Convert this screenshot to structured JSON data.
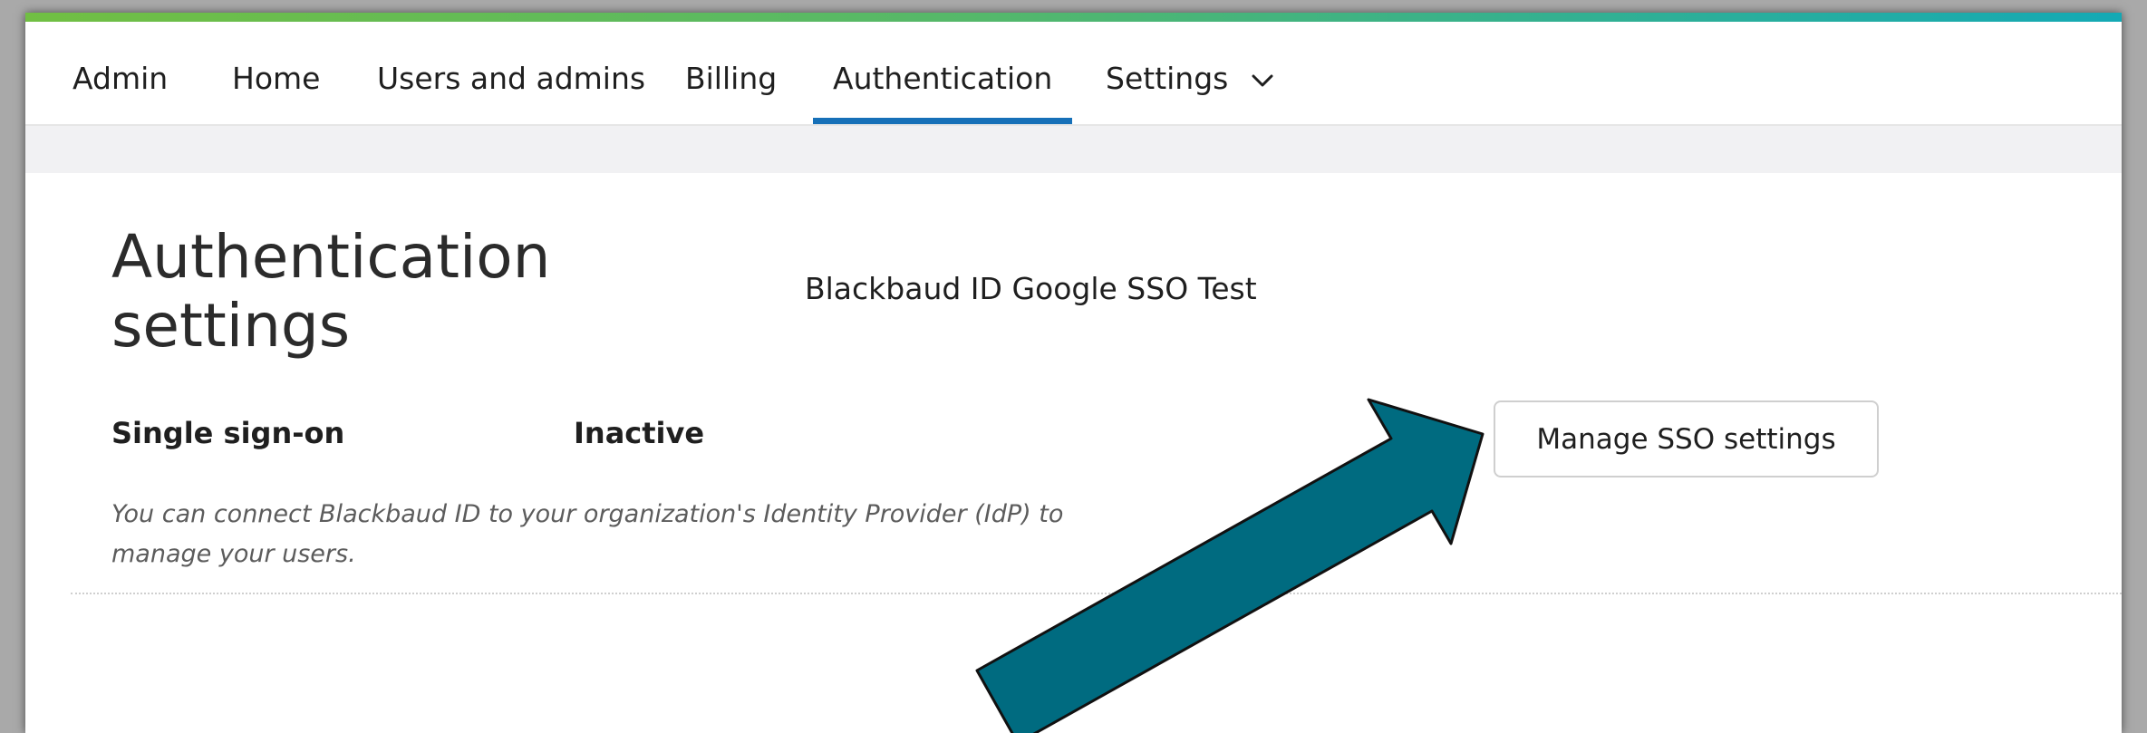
{
  "nav": {
    "items": [
      {
        "label": "Admin"
      },
      {
        "label": "Home"
      },
      {
        "label": "Users and admins"
      },
      {
        "label": "Billing"
      },
      {
        "label": "Authentication",
        "active": true
      },
      {
        "label": "Settings",
        "icon": "chevron-down-icon"
      }
    ]
  },
  "page": {
    "title": "Authentication settings",
    "org_name": "Blackbaud ID Google SSO Test"
  },
  "sso": {
    "label": "Single sign-on",
    "status": "Inactive",
    "description": "You can connect Blackbaud ID to your organization's Identity Provider (IdP) to manage your users.",
    "button_label": "Manage SSO settings"
  },
  "annotation": {
    "icon": "annotation-arrow-icon",
    "color": "#006b80"
  },
  "colors": {
    "accent_start": "#71bf43",
    "accent_end": "#14a9b5",
    "active_tab_underline": "#1670b8"
  }
}
